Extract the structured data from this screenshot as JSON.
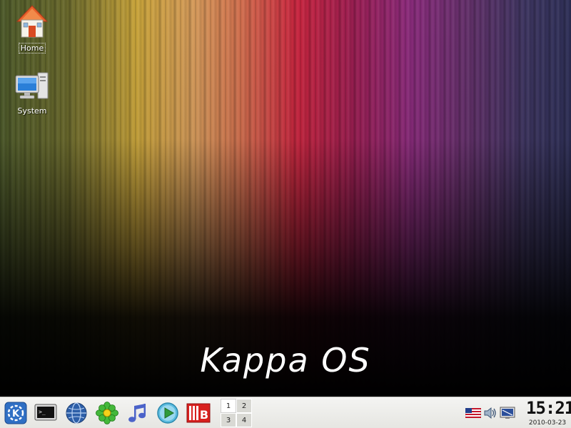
{
  "desktop": {
    "icons": [
      {
        "label": "Home",
        "icon": "home-icon"
      },
      {
        "label": "System",
        "icon": "computer-icon"
      }
    ],
    "branding": "Kappa OS"
  },
  "taskbar": {
    "launchers": [
      {
        "name": "kde-menu-icon"
      },
      {
        "name": "terminal-icon"
      },
      {
        "name": "web-browser-icon"
      },
      {
        "name": "icq-flower-icon"
      },
      {
        "name": "music-note-icon"
      },
      {
        "name": "media-player-icon"
      },
      {
        "name": "mb-app-icon"
      }
    ],
    "pager": {
      "desktops": [
        "1",
        "2",
        "3",
        "4"
      ],
      "active": "1"
    },
    "tray": [
      {
        "name": "us-flag-keyboard-icon"
      },
      {
        "name": "volume-speaker-icon"
      },
      {
        "name": "network-monitor-icon"
      }
    ],
    "clock": {
      "time": "15:21",
      "date": "2010-03-23"
    }
  },
  "colors": {
    "taskbar_bg": "#eeeeea",
    "kde_blue": "#2f6fc4",
    "brand_text": "#ffffff"
  }
}
